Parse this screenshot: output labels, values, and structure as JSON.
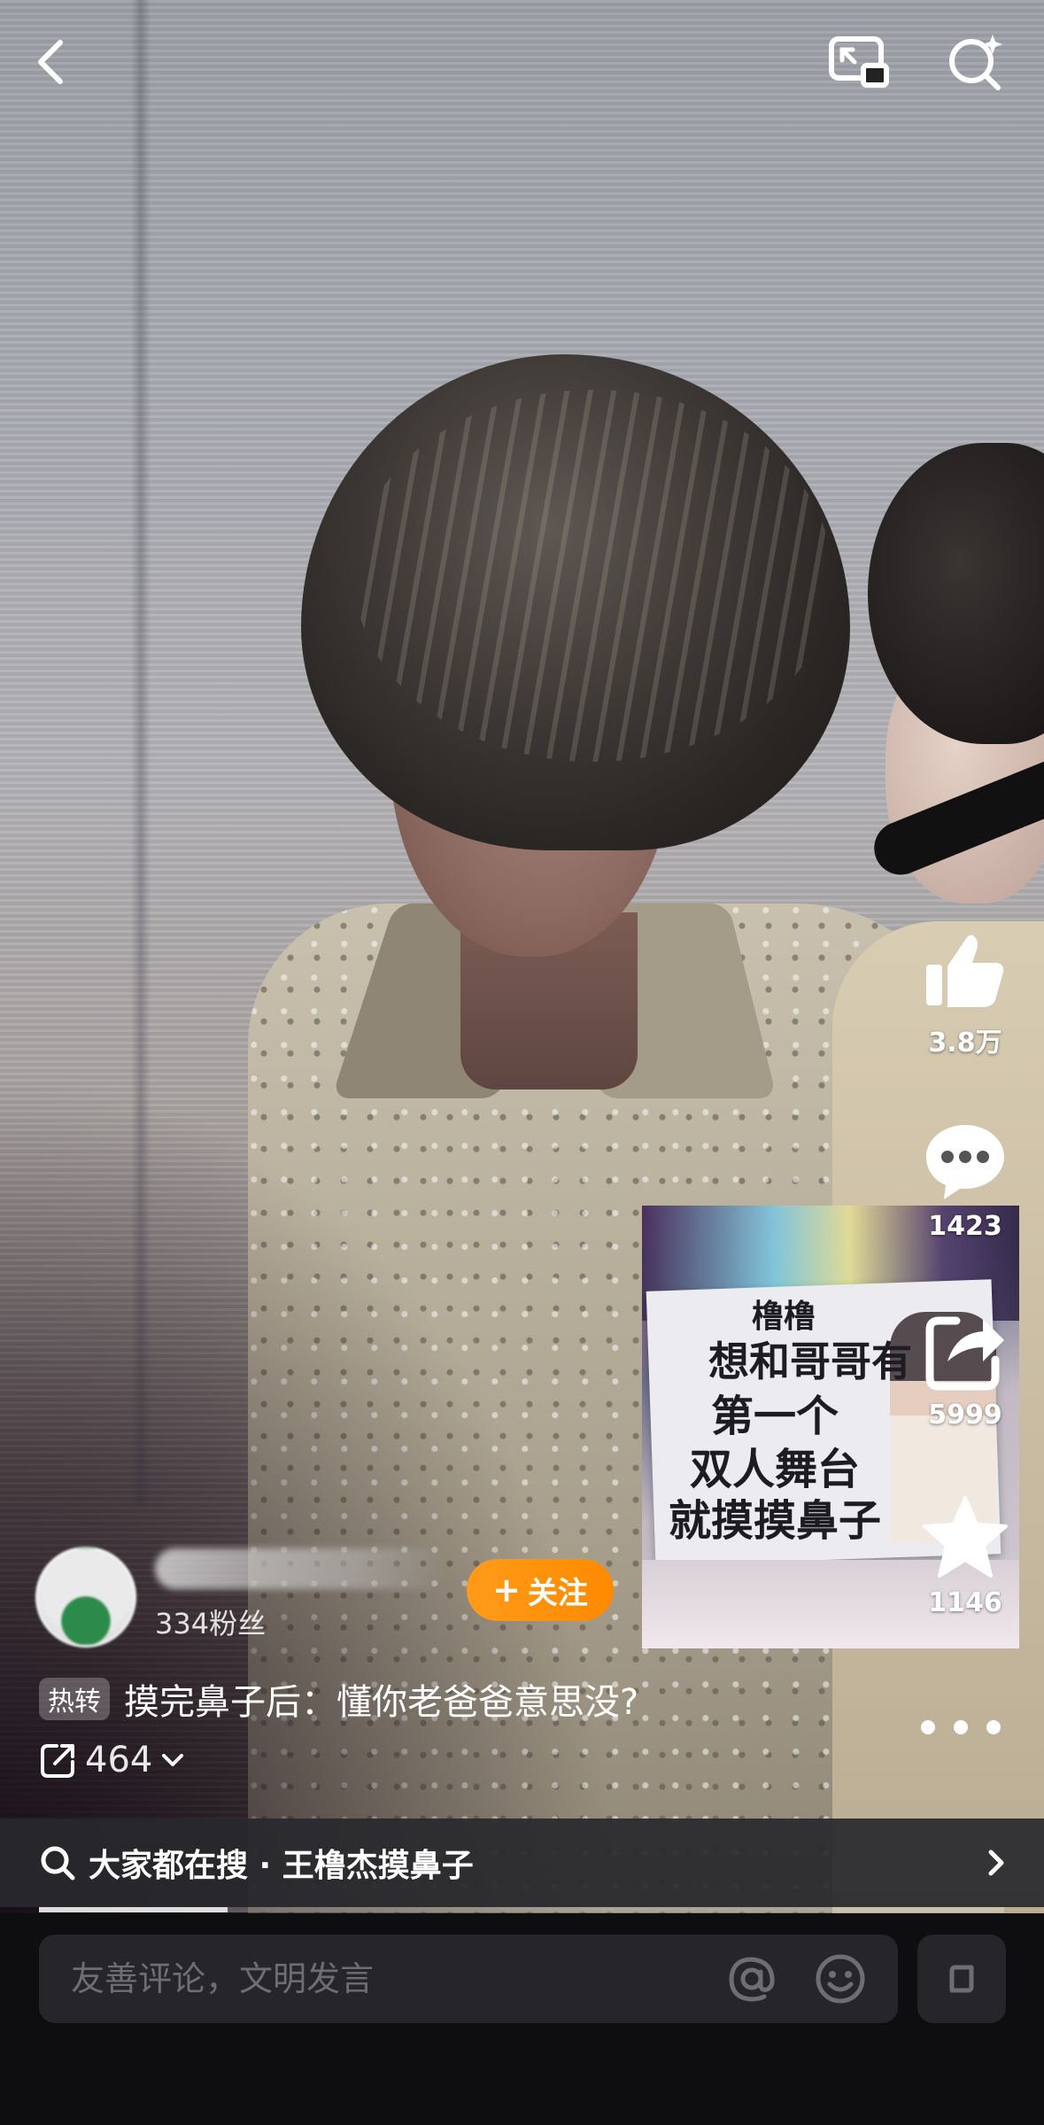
{
  "top_bar": {
    "back_icon": "chevron-left-icon",
    "pip_icon": "picture-in-picture-icon",
    "search_icon": "search-sparkle-icon"
  },
  "actions": {
    "like": {
      "icon": "thumbs-up-icon",
      "count": "3.8万"
    },
    "comment": {
      "icon": "comment-bubble-icon",
      "count": "1423"
    },
    "share": {
      "icon": "share-icon",
      "count": "5999"
    },
    "favorite": {
      "icon": "star-icon",
      "count": "1146"
    },
    "more_icon": "more-dots-icon"
  },
  "sign_photo": {
    "lines": [
      "橹橹",
      "想和哥哥有",
      "第一个",
      "双人舞台",
      "就摸摸鼻子"
    ]
  },
  "author": {
    "name": "",
    "fans": "334粉丝",
    "follow_label": "关注"
  },
  "caption": {
    "tag": "热转",
    "text": "摸完鼻子后：懂你老爸爸意思没?",
    "repost_count": "464"
  },
  "hot_search": {
    "label": "大家都在搜 · 王橹杰摸鼻子"
  },
  "progress": {
    "fraction": 0.195
  },
  "comment_bar": {
    "placeholder": "友善评论，文明发言",
    "mention_icon": "at-icon",
    "emoji_icon": "emoji-icon",
    "expand_icon": "expand-icon"
  },
  "colors": {
    "follow_button": "#ff8a00",
    "input_bg": "#26262a",
    "bar_bg": "#0e0e10"
  }
}
